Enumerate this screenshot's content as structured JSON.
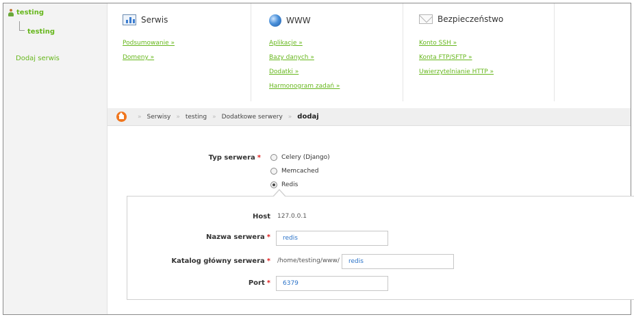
{
  "sidebar": {
    "root_label": "testing",
    "child_label": "testing",
    "add_service": "Dodaj serwis"
  },
  "menu": {
    "serwis": {
      "title": "Serwis",
      "links": [
        "Podsumowanie »",
        "Domeny »"
      ]
    },
    "www": {
      "title": "WWW",
      "links": [
        "Aplikacje »",
        "Bazy danych »",
        "Dodatki »",
        "Harmonogram zadań »"
      ]
    },
    "bezpieczenstwo": {
      "title": "Bezpieczeństwo",
      "links": [
        "Konto SSH »",
        "Konta FTP/SFTP »",
        "Uwierzytelnianie HTTP »"
      ]
    }
  },
  "breadcrumb": {
    "sep": "»",
    "items": [
      "Serwisy",
      "testing",
      "Dodatkowe serwery"
    ],
    "current": "dodaj"
  },
  "form": {
    "type_label": "Typ serwera",
    "required_mark": "*",
    "options": [
      "Celery (Django)",
      "Memcached",
      "Redis"
    ],
    "selected_option": "Redis",
    "host_label": "Host",
    "host_value": "127.0.0.1",
    "name_label": "Nazwa serwera",
    "name_value": "redis",
    "dir_label": "Katalog główny serwera",
    "dir_prefix": "/home/testing/www/",
    "dir_value": "redis",
    "port_label": "Port",
    "port_value": "6379"
  },
  "colors": {
    "accent_green": "#67b71d",
    "required_red": "#e02020",
    "home_orange": "#f0761e"
  }
}
